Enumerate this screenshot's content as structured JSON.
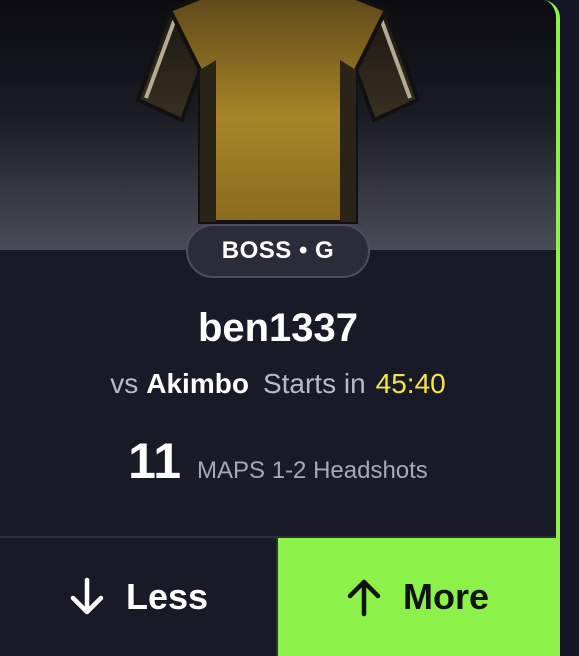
{
  "player": {
    "badge": "BOSS • G",
    "name": "ben1337",
    "vs_prefix": "vs",
    "opponent": "Akimbo",
    "starts_label": "Starts in",
    "countdown": "45:40"
  },
  "projection": {
    "line": "11",
    "stat": "MAPS 1-2 Headshots"
  },
  "actions": {
    "less_label": "Less",
    "more_label": "More"
  },
  "icons": {
    "jersey": "jersey-icon",
    "less": "arrow-down-icon",
    "more": "arrow-up-icon"
  },
  "colors": {
    "accent": "#8cf24a",
    "countdown": "#f4e34a",
    "card_bg": "#191a28",
    "jersey_gold": "#b08a2a"
  }
}
